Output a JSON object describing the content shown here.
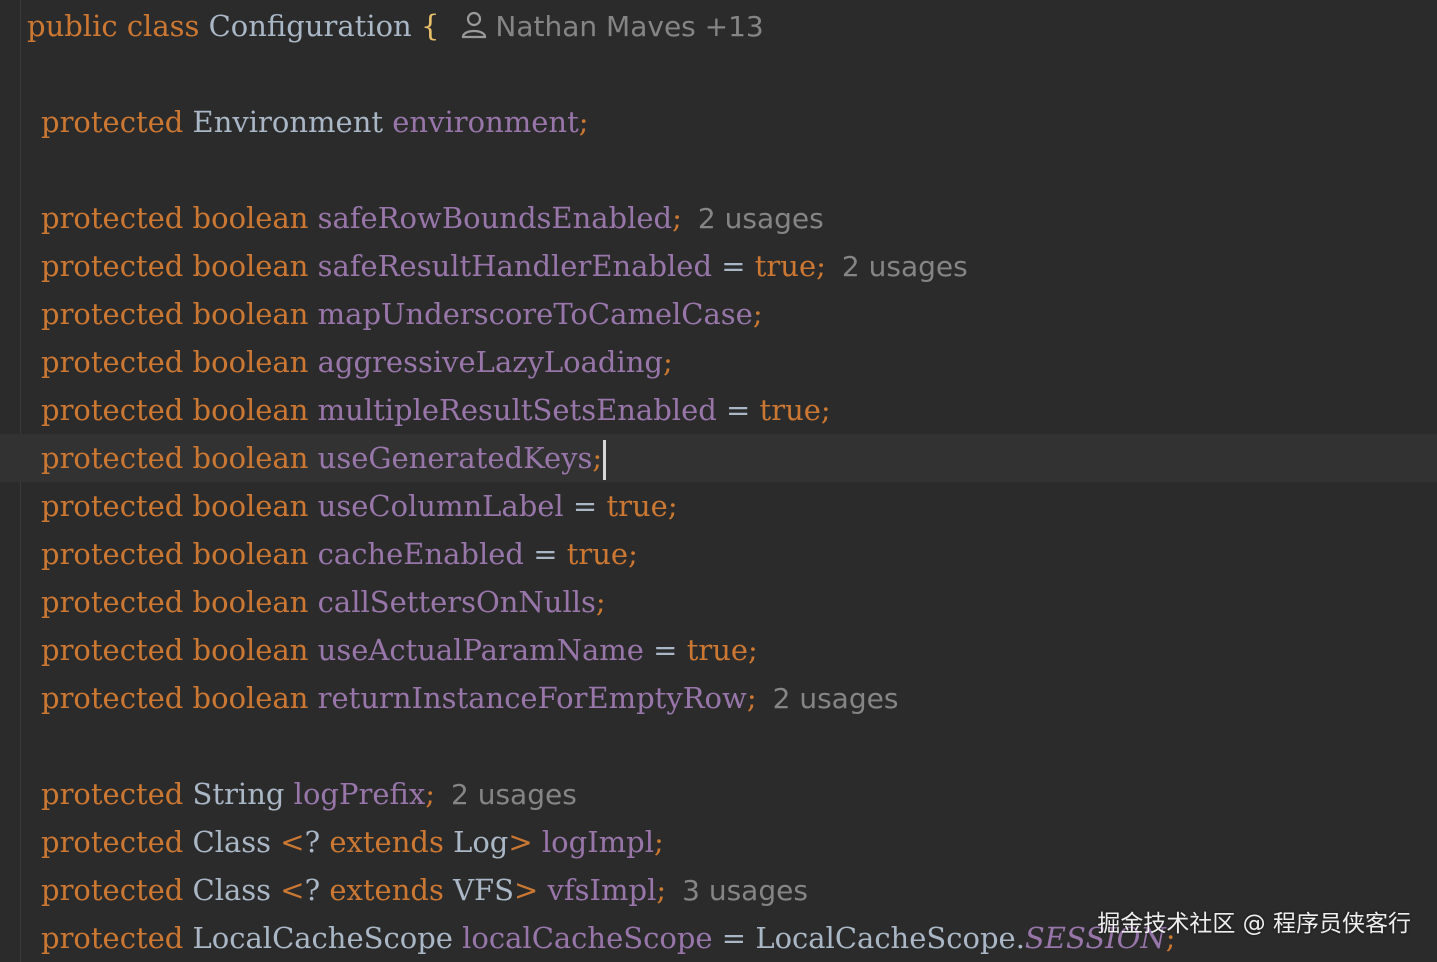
{
  "header": {
    "keywords": "public class",
    "class_name": "Configuration",
    "brace": "{",
    "author": "Nathan Maves +13"
  },
  "kw": {
    "protected": "protected",
    "boolean": "boolean",
    "extends": "extends",
    "true": "true"
  },
  "hint": {
    "two": "2 usages",
    "three": "3 usages"
  },
  "fields": {
    "environment": {
      "type": "Environment",
      "name": "environment"
    },
    "safeRowBoundsEnabled": "safeRowBoundsEnabled",
    "safeResultHandlerEnabled": "safeResultHandlerEnabled",
    "mapUnderscoreToCamelCase": "mapUnderscoreToCamelCase",
    "aggressiveLazyLoading": "aggressiveLazyLoading",
    "multipleResultSetsEnabled": "multipleResultSetsEnabled",
    "useGeneratedKeys": "useGeneratedKeys",
    "useColumnLabel": "useColumnLabel",
    "cacheEnabled": "cacheEnabled",
    "callSettersOnNulls": "callSettersOnNulls",
    "useActualParamName": "useActualParamName",
    "returnInstanceForEmptyRow": "returnInstanceForEmptyRow",
    "logPrefix": {
      "type": "String",
      "name": "logPrefix"
    },
    "logImpl": {
      "type": "Class",
      "bound": "Log",
      "name": "logImpl"
    },
    "vfsImpl": {
      "type": "Class",
      "bound": "VFS",
      "name": "vfsImpl"
    },
    "localCacheScope": {
      "type": "LocalCacheScope",
      "name": "localCacheScope",
      "value_owner": "LocalCacheScope",
      "value_const": "SESSION"
    }
  },
  "watermark": "掘金技术社区 @ 程序员侠客行",
  "colors": {
    "background": "#2b2b2b",
    "keyword": "#cc7832",
    "field": "#9876aa",
    "plain": "#a9b7c6",
    "hint": "#858585",
    "current_line": "#323232"
  }
}
